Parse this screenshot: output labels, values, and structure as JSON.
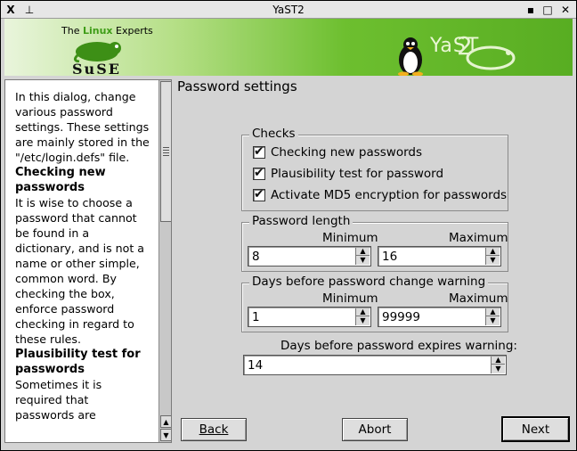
{
  "window": {
    "title": "YaST2",
    "menu_glyph": "X",
    "pin_glyph": "⊥",
    "minimize_glyph": "▪",
    "maximize_glyph": "□",
    "close_glyph": "✕"
  },
  "banner": {
    "tagline_pre": "The ",
    "tagline_hl": "Linux",
    "tagline_post": " Experts",
    "suse_logo_text": "SuSE",
    "yast_logo_text": "YaST"
  },
  "help": {
    "intro": "In this dialog, change various password settings. These settings are mainly stored in the \"/etc/login.defs\" file.",
    "sections": [
      {
        "heading": "Checking new passwords",
        "body": "It is wise to choose a password that cannot be found in a dictionary, and is not a name or other simple, common word. By checking the box, enforce password checking in regard to these rules."
      },
      {
        "heading": "Plausibility test for passwords",
        "body": "Sometimes it is required that passwords are"
      }
    ]
  },
  "heading": "Password settings",
  "checks": {
    "title": "Checks",
    "items": [
      {
        "label": "Checking new passwords",
        "checked": true
      },
      {
        "label": "Plausibility test for password",
        "checked": true
      },
      {
        "label": "Activate MD5 encryption for passwords",
        "checked": true
      }
    ]
  },
  "password_length": {
    "title": "Password length",
    "min_label": "Minimum",
    "max_label": "Maximum",
    "min_value": "8",
    "max_value": "16"
  },
  "warning_days": {
    "title": "Days before password change warning",
    "min_label": "Minimum",
    "max_label": "Maximum",
    "min_value": "1",
    "max_value": "99999"
  },
  "expire_warning": {
    "label": "Days before password expires warning:",
    "value": "14"
  },
  "buttons": {
    "back": "Back",
    "abort": "Abort",
    "next": "Next"
  }
}
